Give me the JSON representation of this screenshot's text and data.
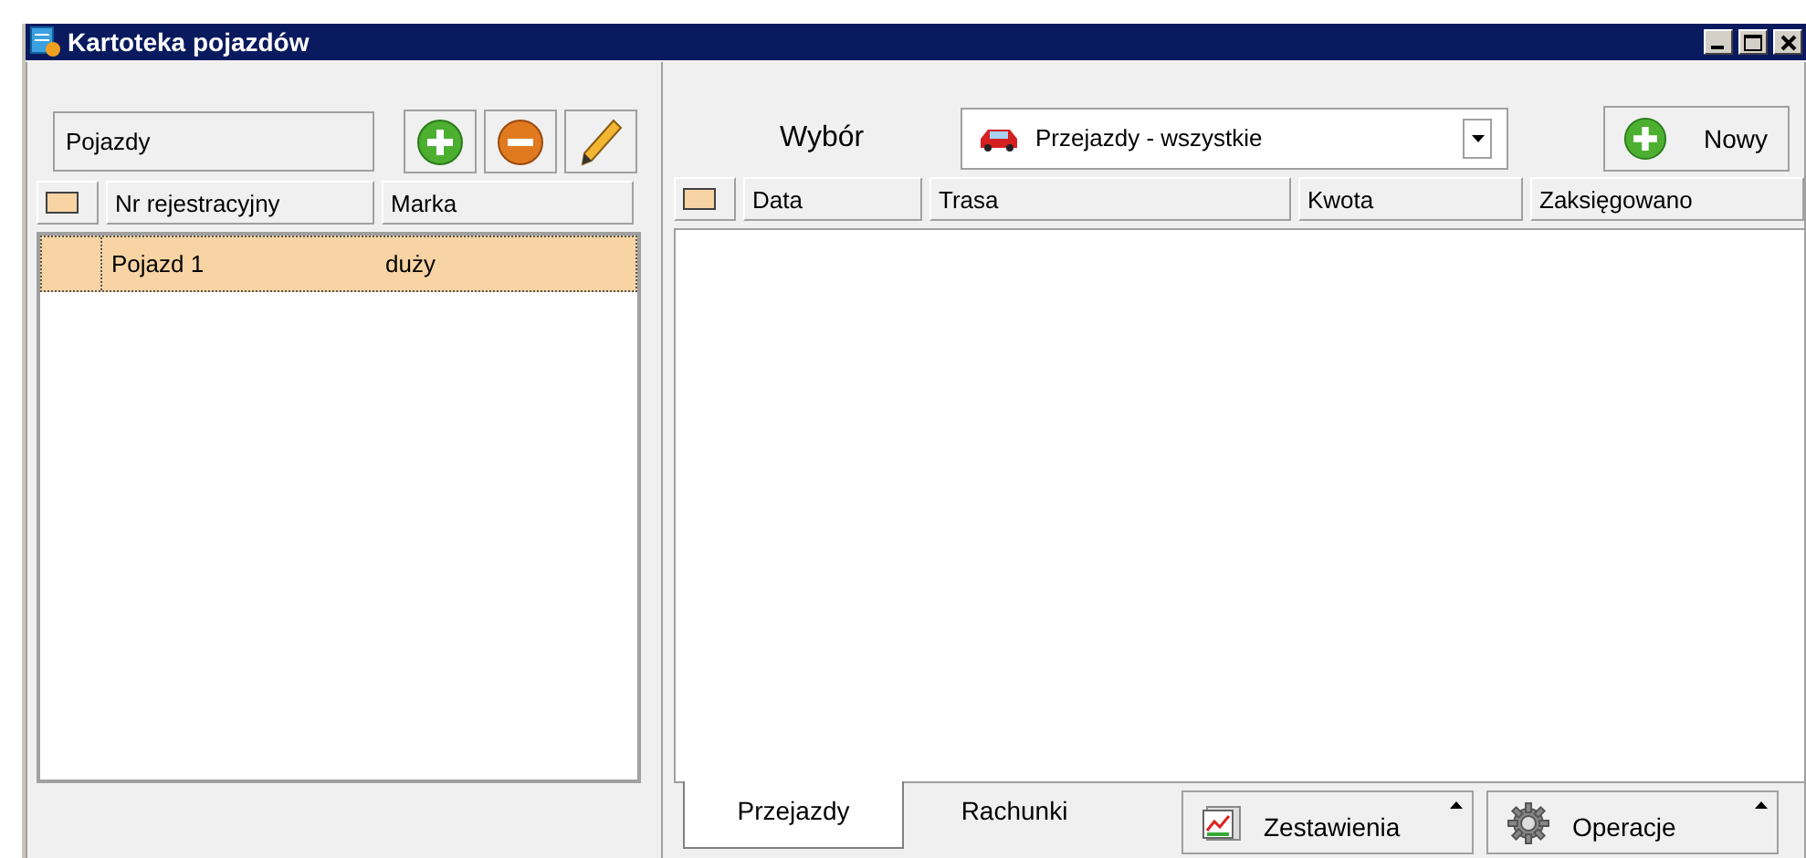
{
  "window": {
    "title": "Kartoteka pojazdów"
  },
  "left_panel": {
    "field": {
      "value": "Pojazdy"
    },
    "table": {
      "columns": [
        "Nr rejestracyjny",
        "Marka"
      ],
      "rows": [
        {
          "cells": [
            "Pojazd 1",
            "duży"
          ],
          "selected": true
        }
      ]
    }
  },
  "right_panel": {
    "filter_label": "Wybór",
    "filter": {
      "value": "Przejazdy - wszystkie"
    },
    "new_button": "Nowy",
    "table": {
      "columns": [
        "Data",
        "Trasa",
        "Kwota",
        "Zaksięgowano"
      ]
    },
    "tabs": [
      {
        "label": "Przejazdy",
        "selected": true
      },
      {
        "label": "Rachunki",
        "selected": false
      }
    ],
    "menus": [
      {
        "label": "Zestawienia",
        "kind": "chart"
      },
      {
        "label": "Operacje",
        "kind": "gear"
      }
    ]
  }
}
